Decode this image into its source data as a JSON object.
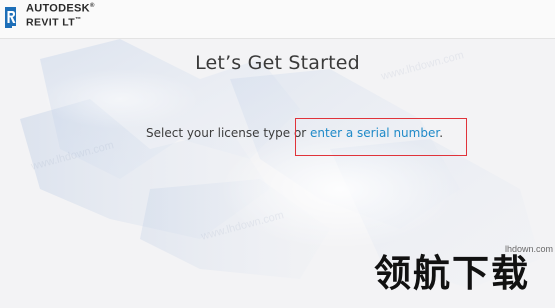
{
  "header": {
    "brand_top": "AUTODESK",
    "brand_top_mark": "®",
    "brand_bottom": "REVIT LT",
    "brand_bottom_mark": "™",
    "logo_icon": "revit-r-icon"
  },
  "main": {
    "title": "Let’s Get Started",
    "prompt_text": "Select your license type or ",
    "serial_link": "enter a serial number",
    "prompt_end": "."
  },
  "watermark": {
    "logo": "领航下载",
    "site": "lhdown.com",
    "faint_text": "www.lhdown.com"
  },
  "colors": {
    "link": "#1f8ac8",
    "highlight_border": "#e0333a",
    "logo_blue": "#1d6fb8"
  }
}
